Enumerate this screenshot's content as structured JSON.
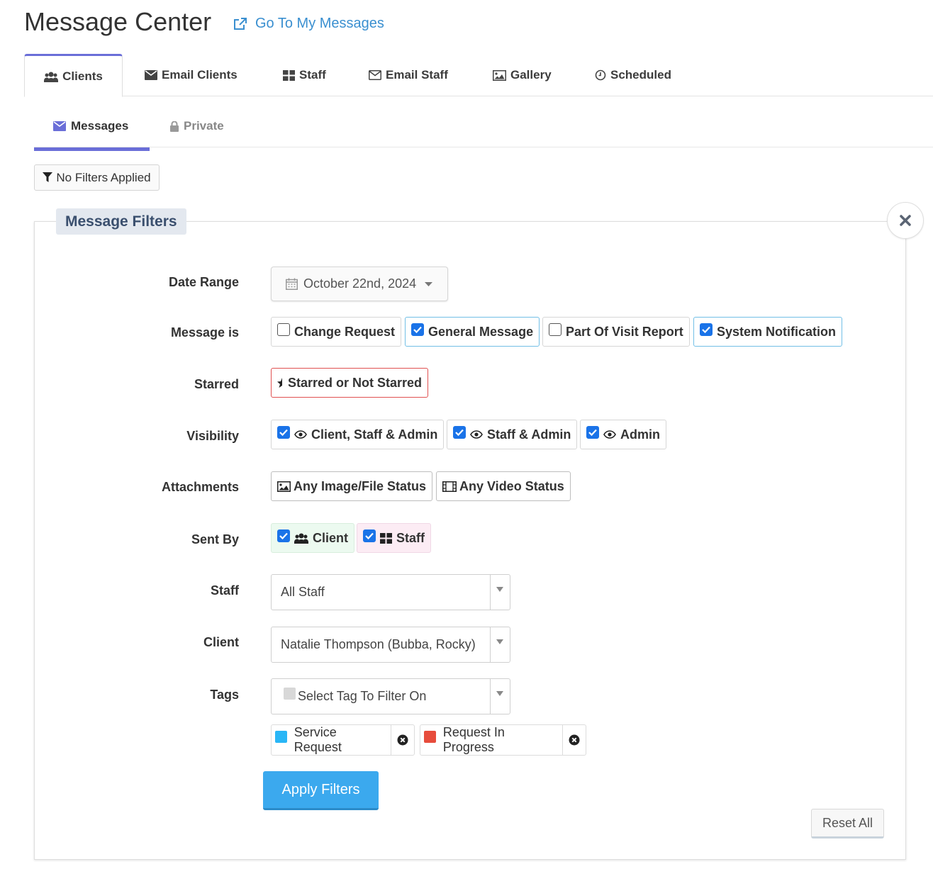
{
  "header": {
    "title": "Message Center",
    "link_label": "Go To My Messages"
  },
  "tabs": [
    {
      "label": "Clients",
      "icon": "users-icon",
      "active": true
    },
    {
      "label": "Email Clients",
      "icon": "envelope-icon"
    },
    {
      "label": "Staff",
      "icon": "grid-icon"
    },
    {
      "label": "Email Staff",
      "icon": "envelope-outline-icon"
    },
    {
      "label": "Gallery",
      "icon": "image-icon"
    },
    {
      "label": "Scheduled",
      "icon": "clock-icon"
    }
  ],
  "subtabs": [
    {
      "label": "Messages",
      "icon": "envelope-icon",
      "active": true
    },
    {
      "label": "Private",
      "icon": "lock-icon"
    }
  ],
  "filter_status": "No Filters Applied",
  "filters": {
    "title": "Message Filters",
    "labels": {
      "date_range": "Date Range",
      "message_is": "Message is",
      "starred": "Starred",
      "visibility": "Visibility",
      "attachments": "Attachments",
      "sent_by": "Sent By",
      "staff": "Staff",
      "client": "Client",
      "tags": "Tags"
    },
    "date_range": "October 22nd, 2024",
    "message_types": [
      {
        "label": "Change Request",
        "checked": false
      },
      {
        "label": "General Message",
        "checked": true
      },
      {
        "label": "Part Of Visit Report",
        "checked": false
      },
      {
        "label": "System Notification",
        "checked": true
      }
    ],
    "starred": "Starred or Not Starred",
    "visibility": [
      {
        "label": "Client, Staff & Admin",
        "checked": true
      },
      {
        "label": "Staff & Admin",
        "checked": true
      },
      {
        "label": "Admin",
        "checked": true
      }
    ],
    "attachments": [
      {
        "label": "Any Image/File Status",
        "icon": "image-icon"
      },
      {
        "label": "Any Video Status",
        "icon": "film-icon"
      }
    ],
    "sent_by": [
      {
        "label": "Client",
        "checked": true,
        "icon": "users-icon"
      },
      {
        "label": "Staff",
        "checked": true,
        "icon": "grid-icon"
      }
    ],
    "staff_value": "All Staff",
    "client_value": "Natalie Thompson (Bubba, Rocky)",
    "tags_placeholder": "Select Tag To Filter On",
    "selected_tags": [
      {
        "label": "Service Request",
        "color": "#29b6f6"
      },
      {
        "label": "Request In Progress",
        "color": "#e74c3c"
      }
    ],
    "apply_label": "Apply Filters",
    "reset_label": "Reset All"
  },
  "colors": {
    "accent": "#6a6ed8",
    "link": "#3a8fd0",
    "primary_button": "#3ba9ee",
    "checkbox": "#1a73e8"
  }
}
